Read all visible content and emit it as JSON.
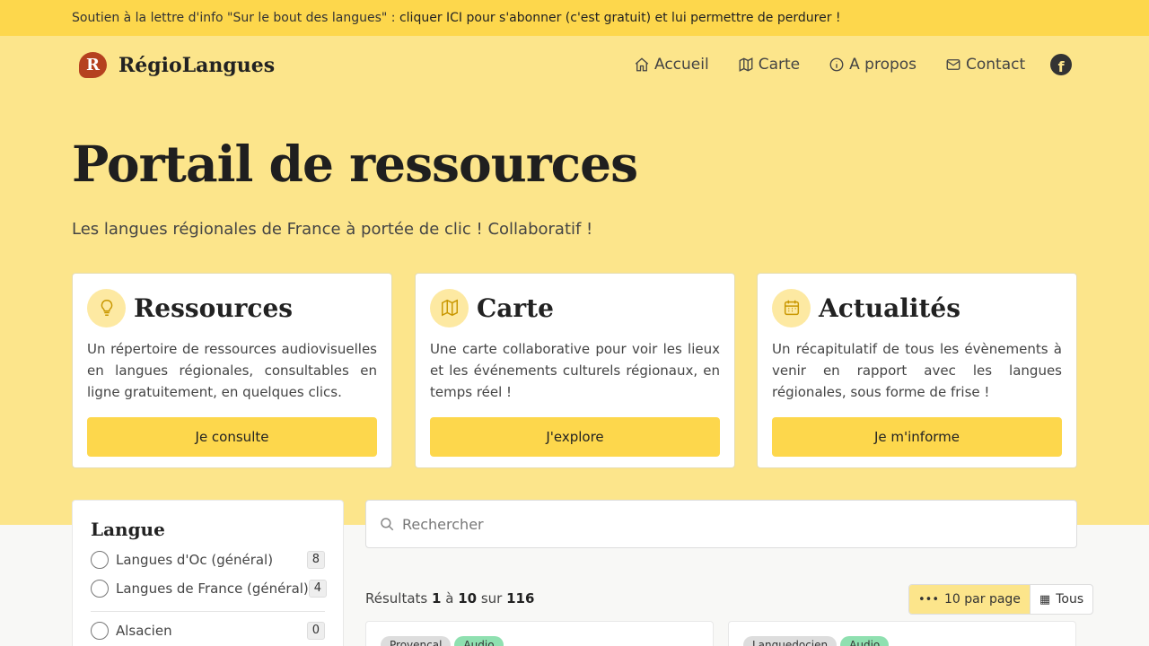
{
  "topbar": {
    "text": "Soutien à la lettre d'info \"Sur le bout des langues\" : ",
    "link": "cliquer ICI pour s'abonner (c'est gratuit) et lui permettre de perdurer !"
  },
  "brand": {
    "logo_letter": "R",
    "name": "RégioLangues"
  },
  "nav": {
    "home": "Accueil",
    "map": "Carte",
    "about": "A propos",
    "contact": "Contact",
    "facebook_letter": "f"
  },
  "hero": {
    "title": "Portail de ressources",
    "subtitle": "Les langues régionales de France à portée de clic ! Collaboratif !"
  },
  "cards": [
    {
      "title": "Ressources",
      "icon": "lightbulb-icon",
      "text": "Un répertoire de ressources audiovisuelles en langues régionales, consultables en ligne gratuitement, en quelques clics.",
      "button": "Je consulte"
    },
    {
      "title": "Carte",
      "icon": "map-icon",
      "text": "Une carte collaborative pour voir les lieux et les événements culturels régionaux, en temps réel !",
      "button": "J'explore"
    },
    {
      "title": "Actualités",
      "icon": "calendar-icon",
      "text": "Un récapitulatif de tous les évènements à venir en rapport avec les langues régionales, sous forme de frise !",
      "button": "Je m'informe"
    }
  ],
  "sidebar": {
    "heading": "Langue",
    "items": [
      {
        "label": "Langues d'Oc (général)",
        "count": "8"
      },
      {
        "label": "Langues de France (général)",
        "count": "4"
      },
      {
        "label": "Alsacien",
        "count": "0"
      }
    ]
  },
  "search": {
    "placeholder": "Rechercher"
  },
  "results": {
    "prefix": "Résultats ",
    "from": "1",
    "mid": " à ",
    "to": "10",
    "sur": " sur ",
    "total": "116"
  },
  "pager": {
    "per_page": "10 par page",
    "all": "Tous"
  },
  "result_cards": [
    {
      "tags": [
        "Provençal",
        "Audio"
      ]
    },
    {
      "tags": [
        "Languedocien",
        "Audio"
      ]
    }
  ],
  "colors": {
    "accent": "#fdd74c",
    "hero_bg": "#fce58b",
    "brand": "#b5411f"
  }
}
